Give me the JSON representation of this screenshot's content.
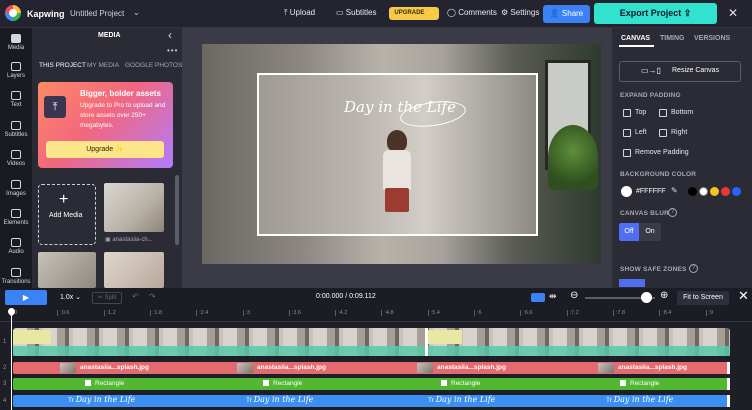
{
  "app": {
    "brand": "Kapwing",
    "project_title": "Untitled Project"
  },
  "topbar": {
    "upload_label": "Upload",
    "subtitles_label": "Subtitles",
    "upgrade_label": "UPGRADE ✨",
    "comments_label": "Comments",
    "settings_label": "Settings",
    "share_label": "Share",
    "export_label": "Export Project"
  },
  "nav": {
    "items": [
      {
        "label": "Media"
      },
      {
        "label": "Layers"
      },
      {
        "label": "Text"
      },
      {
        "label": "Subtitles"
      },
      {
        "label": "Videos"
      },
      {
        "label": "Images"
      },
      {
        "label": "Elements"
      },
      {
        "label": "Audio"
      },
      {
        "label": "Transitions"
      }
    ]
  },
  "media": {
    "title": "MEDIA",
    "tabs": [
      {
        "label": "THIS PROJECT"
      },
      {
        "label": "MY MEDIA"
      },
      {
        "label": "GOOGLE PHOTOS"
      }
    ],
    "promo": {
      "title": "Bigger, bolder assets",
      "body": "Upgrade to Pro to upload and store assets over 250+ megabytes.",
      "button": "Upgrade ✨"
    },
    "add_label": "Add Media",
    "thumb_label": "anastasiia-ch..."
  },
  "canvas": {
    "title_text": "Day in the Life"
  },
  "right": {
    "tabs": [
      {
        "label": "CANVAS"
      },
      {
        "label": "TIMING"
      },
      {
        "label": "VERSIONS"
      }
    ],
    "resize_label": "Resize Canvas",
    "expand_heading": "EXPAND PADDING",
    "pad": {
      "top": "Top",
      "bottom": "Bottom",
      "left": "Left",
      "right": "Right",
      "remove": "Remove Padding"
    },
    "bg_heading": "BACKGROUND COLOR",
    "bg_hex": "#FFFFFF",
    "bg_colors": [
      "#000000",
      "#ffffff",
      "#f5c518",
      "#e53935",
      "#2962ff"
    ],
    "blur_heading": "CANVAS BLUR",
    "blur_off": "Off",
    "blur_on": "On",
    "safe_heading": "SHOW SAFE ZONES"
  },
  "timeline": {
    "speed": "1.0x",
    "split": "Split",
    "timecode": "0:00.000 / 0:09.112",
    "fit_label": "Fit to Screen",
    "ticks": [
      "0",
      ":0.6",
      ":1.2",
      ":1.8",
      ":2.4",
      ":3",
      ":3.6",
      ":4.2",
      ":4.8",
      ":5.4",
      ":6",
      ":6.6",
      ":7.2",
      ":7.8",
      ":8.4",
      ":9"
    ],
    "track_numbers": [
      "1",
      "2",
      "3",
      "4"
    ],
    "image_clip_label": "anastasiia...splash.jpg",
    "rect_label": "Rectangle",
    "text_label": "Day in the Life"
  }
}
